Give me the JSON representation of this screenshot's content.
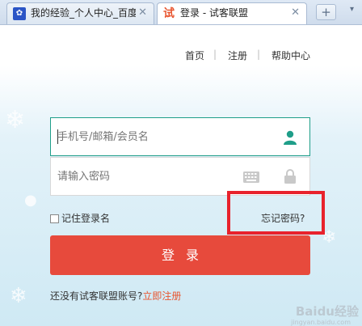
{
  "browser": {
    "tabs": [
      {
        "favicon": "baidu-paw-icon",
        "favicon_glyph": "✿",
        "title": "我的经验_个人中心_百度经验"
      },
      {
        "favicon": "shike-logo-icon",
        "favicon_glyph": "试",
        "title": "登录 - 试客联盟"
      }
    ],
    "new_tab_label": "+",
    "tab_menu_glyph": "▾"
  },
  "nav": {
    "home": "首页",
    "register": "注册",
    "help": "帮助中心"
  },
  "form": {
    "username_placeholder": "手机号/邮箱/会员名",
    "password_placeholder": "请输入密码",
    "remember_label": "记住登录名",
    "forgot_label": "忘记密码?",
    "login_label": "登录",
    "no_account_text": "还没有试客联盟账号?",
    "signup_link": "立即注册"
  },
  "colors": {
    "accent": "#1f9e89",
    "login_button": "#e74a3c",
    "highlight": "#e8222c",
    "link": "#e8552f"
  },
  "watermark": {
    "text": "Baidu经验",
    "sub": "jingyan.baidu.com"
  }
}
